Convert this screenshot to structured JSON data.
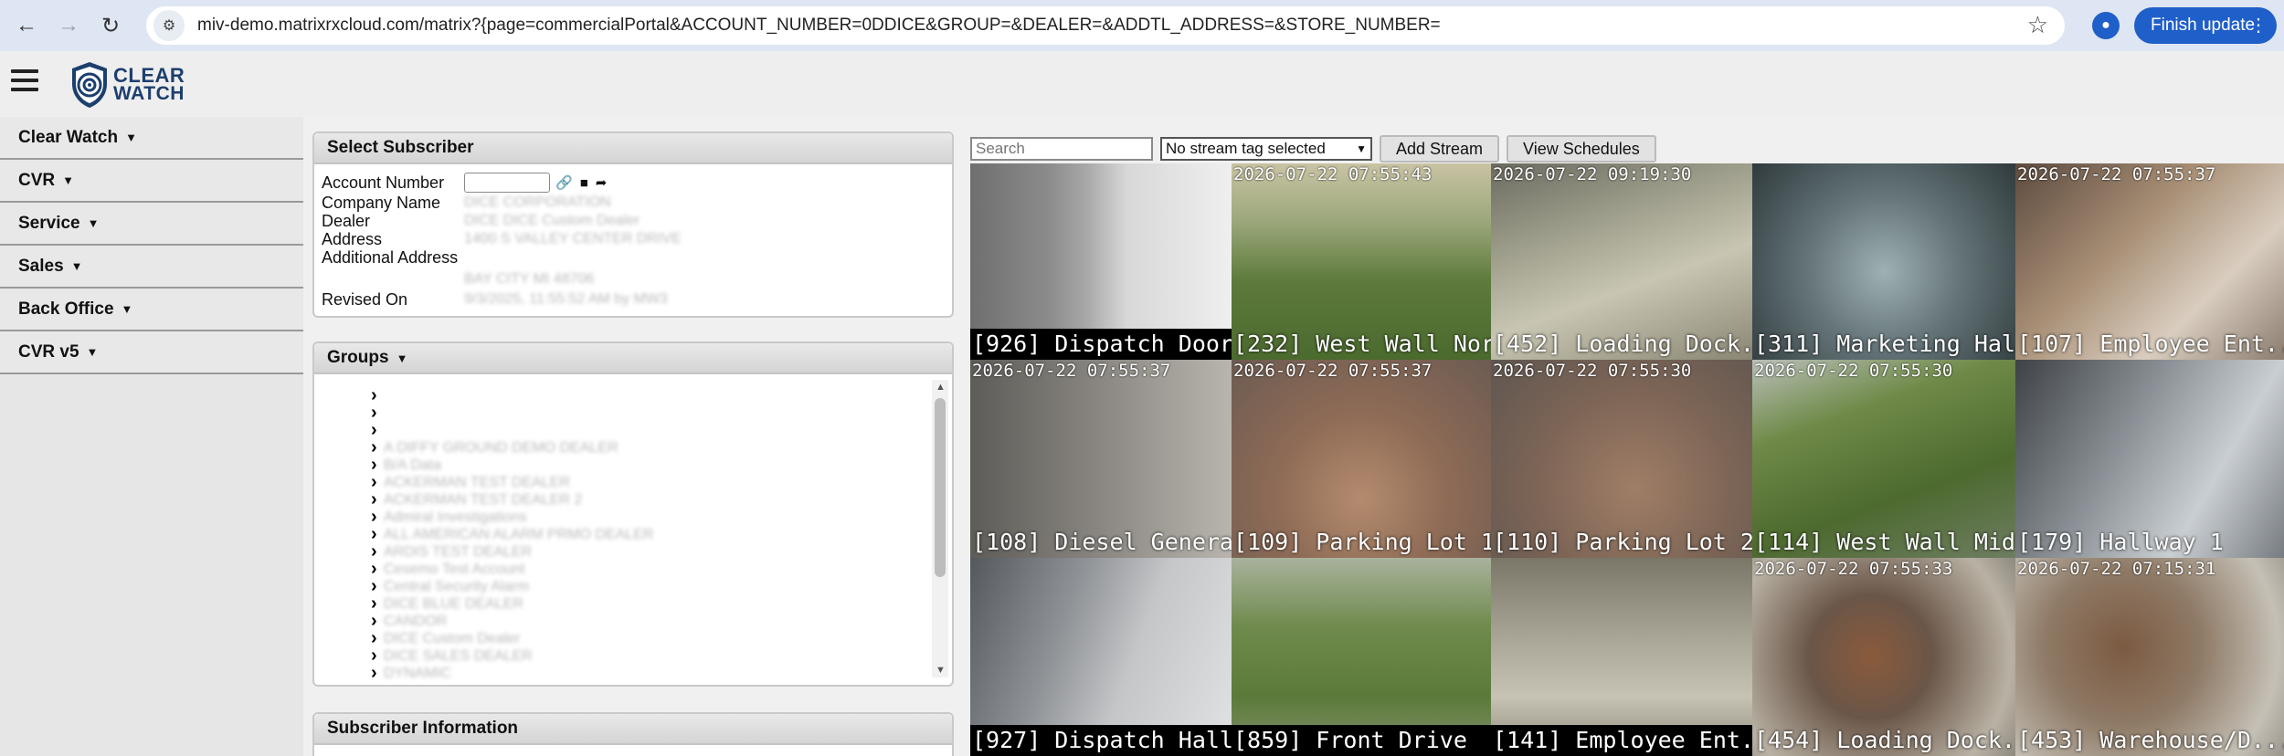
{
  "browser": {
    "url": "miv-demo.matrixrxcloud.com/matrix?{page=commercialPortal&ACCOUNT_NUMBER=0DDICE&GROUP=&DEALER=&ADDTL_ADDRESS=&STORE_NUMBER=",
    "finish_update_label": "Finish update"
  },
  "app": {
    "logo_line1": "CLEAR",
    "logo_line2": "WATCH"
  },
  "sidebar": {
    "items": [
      {
        "label": "Clear Watch"
      },
      {
        "label": "CVR"
      },
      {
        "label": "Service"
      },
      {
        "label": "Sales"
      },
      {
        "label": "Back Office"
      },
      {
        "label": "CVR v5"
      }
    ]
  },
  "select_subscriber": {
    "title": "Select Subscriber",
    "labels": {
      "account_number": "Account Number",
      "company_name": "Company Name",
      "dealer": "Dealer",
      "address": "Address",
      "additional_address": "Additional Address",
      "revised_on": "Revised On"
    },
    "values": {
      "company_name": "DICE CORPORATION",
      "dealer": "DICE    DICE Custom Dealer",
      "address": "1400    S    VALLEY CENTER DRIVE",
      "city_line": "BAY CITY    MI    48706",
      "revised_on": "9/3/2025, 11:55:52 AM   by   MW3"
    }
  },
  "groups": {
    "title": "Groups",
    "items": [
      "",
      "",
      "",
      "A DIFFY GROUND DEMO DEALER",
      "B/A Data",
      "ACKERMAN TEST DEALER",
      "ACKERMAN TEST DEALER 2",
      "Admiral Investigations",
      "ALL AMERICAN ALARM PRMO DEALER",
      "ARDIS TEST DEALER",
      "Cesemo Test Account",
      "Central Security Alarm",
      "DICE BLUE DEALER",
      "CANDOR",
      "DICE Custom Dealer",
      "DICE SALES DEALER",
      "DYNAMIC"
    ]
  },
  "subscriber_information": {
    "title": "Subscriber Information"
  },
  "stream_toolbar": {
    "search_placeholder": "Search",
    "tag_select": "No stream tag selected",
    "add_stream": "Add Stream",
    "view_schedules": "View Schedules"
  },
  "cameras": [
    {
      "label": "[926] Dispatch Door",
      "timestamp": "",
      "scene": "door",
      "dark_label": true
    },
    {
      "label": "[232] West Wall Nor...",
      "timestamp": "2026-07-22 07:55:43",
      "scene": "grass",
      "dark_label": false
    },
    {
      "label": "[452] Loading Dock...",
      "timestamp": "2026-07-22 09:19:30",
      "scene": "dock",
      "dark_label": false
    },
    {
      "label": "[311] Marketing Hal...",
      "timestamp": "",
      "scene": "office",
      "dark_label": false
    },
    {
      "label": "[107] Employee Ent...",
      "timestamp": "2026-07-22 07:55:37",
      "scene": "hallway",
      "dark_label": false
    },
    {
      "label": "[108] Diesel Genera...",
      "timestamp": "2026-07-22 07:55:37",
      "scene": "blur",
      "dark_label": false
    },
    {
      "label": "[109] Parking Lot 1",
      "timestamp": "2026-07-22 07:55:37",
      "scene": "blurbrown",
      "dark_label": false
    },
    {
      "label": "[110] Parking Lot 2",
      "timestamp": "2026-07-22 07:55:30",
      "scene": "blurbrown2",
      "dark_label": false
    },
    {
      "label": "[114] West Wall Mid",
      "timestamp": "2026-07-22 07:55:30",
      "scene": "grass2",
      "dark_label": false
    },
    {
      "label": "[179] Hallway 1",
      "timestamp": "",
      "scene": "hallway2",
      "dark_label": false
    },
    {
      "label": "[927] Dispatch Hall...",
      "timestamp": "",
      "scene": "door2",
      "dark_label": true
    },
    {
      "label": "[859] Front Drive",
      "timestamp": "",
      "scene": "drive",
      "dark_label": true
    },
    {
      "label": "[141] Employee Ent...",
      "timestamp": "",
      "scene": "sidewalk",
      "dark_label": true
    },
    {
      "label": "[454] Loading Dock...",
      "timestamp": "2026-07-22 07:55:33",
      "scene": "clutter",
      "dark_label": false
    },
    {
      "label": "[453] Warehouse/D...",
      "timestamp": "2026-07-22 07:15:31",
      "scene": "clutter2",
      "dark_label": false
    }
  ]
}
